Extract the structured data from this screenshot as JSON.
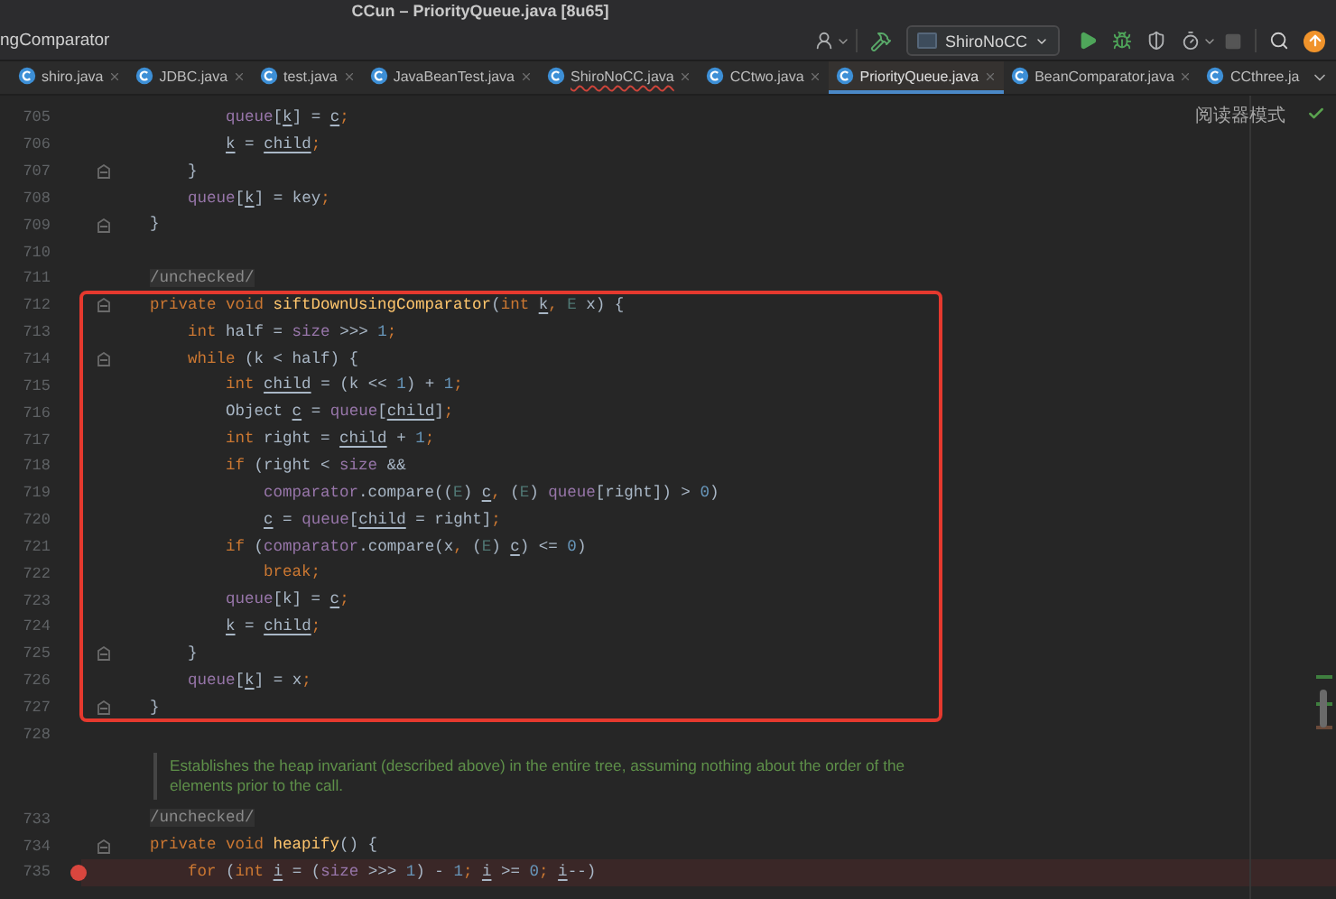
{
  "window": {
    "title": "CCun – PriorityQueue.java [8u65]"
  },
  "toolbar": {
    "breadcrumb": "ngComparator",
    "run_config": "ShiroNoCC"
  },
  "tabs": [
    {
      "label": "shiro.java",
      "selected": false,
      "error": false,
      "closable": true
    },
    {
      "label": "JDBC.java",
      "selected": false,
      "error": false,
      "closable": true
    },
    {
      "label": "test.java",
      "selected": false,
      "error": false,
      "closable": true
    },
    {
      "label": "JavaBeanTest.java",
      "selected": false,
      "error": false,
      "closable": true
    },
    {
      "label": "ShiroNoCC.java",
      "selected": false,
      "error": true,
      "closable": true
    },
    {
      "label": "CCtwo.java",
      "selected": false,
      "error": false,
      "closable": true
    },
    {
      "label": "PriorityQueue.java",
      "selected": true,
      "error": false,
      "closable": true
    },
    {
      "label": "BeanComparator.java",
      "selected": false,
      "error": false,
      "closable": true
    },
    {
      "label": "CCthree.ja",
      "selected": false,
      "error": false,
      "closable": false
    }
  ],
  "editor": {
    "reader_mode": "阅读器模式",
    "sections": [
      {
        "kind": "plain",
        "lines": [
          {
            "number": "705",
            "fold": false,
            "breakpoint": false,
            "tokens": [
              {
                "text": "            queue",
                "kind": "field"
              },
              {
                "text": "[",
                "kind": "plain"
              },
              {
                "text": "k",
                "kind": "var"
              },
              {
                "text": "] = ",
                "kind": "plain"
              },
              {
                "text": "c",
                "kind": "var"
              },
              {
                "text": ";",
                "kind": "punct"
              }
            ]
          },
          {
            "number": "706",
            "fold": false,
            "breakpoint": false,
            "tokens": [
              {
                "text": "            k",
                "kind": "var"
              },
              {
                "text": " = ",
                "kind": "plain"
              },
              {
                "text": "child",
                "kind": "var"
              },
              {
                "text": ";",
                "kind": "punct"
              }
            ]
          },
          {
            "number": "707",
            "fold": true,
            "breakpoint": false,
            "tokens": [
              {
                "text": "        }",
                "kind": "plain"
              }
            ]
          },
          {
            "number": "708",
            "fold": false,
            "breakpoint": false,
            "tokens": [
              {
                "text": "        queue",
                "kind": "field"
              },
              {
                "text": "[",
                "kind": "plain"
              },
              {
                "text": "k",
                "kind": "var"
              },
              {
                "text": "] = key",
                "kind": "plain"
              },
              {
                "text": ";",
                "kind": "punct"
              }
            ]
          },
          {
            "number": "709",
            "fold": true,
            "breakpoint": false,
            "tokens": [
              {
                "text": "    }",
                "kind": "plain"
              }
            ]
          },
          {
            "number": "710",
            "fold": false,
            "breakpoint": false
          },
          {
            "number": "711",
            "fold": false,
            "breakpoint": false,
            "tokens": [
              {
                "text": "    /unchecked/",
                "kind": "annotation"
              }
            ]
          }
        ]
      },
      {
        "kind": "boxed",
        "lines": [
          {
            "number": "712",
            "fold": true,
            "breakpoint": false,
            "tokens": [
              {
                "text": "    private void ",
                "kind": "kw"
              },
              {
                "text": "siftDownUsingComparator",
                "kind": "method"
              },
              {
                "text": "(",
                "kind": "plain"
              },
              {
                "text": "int ",
                "kind": "kw"
              },
              {
                "text": "k",
                "kind": "var"
              },
              {
                "text": ", ",
                "kind": "punct"
              },
              {
                "text": "E",
                "kind": "type"
              },
              {
                "text": " x) {",
                "kind": "plain"
              }
            ]
          },
          {
            "number": "713",
            "fold": false,
            "breakpoint": false,
            "tokens": [
              {
                "text": "        int ",
                "kind": "kw"
              },
              {
                "text": "half = ",
                "kind": "plain"
              },
              {
                "text": "size",
                "kind": "field"
              },
              {
                "text": " >>> ",
                "kind": "plain"
              },
              {
                "text": "1",
                "kind": "num"
              },
              {
                "text": ";",
                "kind": "punct"
              }
            ]
          },
          {
            "number": "714",
            "fold": true,
            "breakpoint": false,
            "tokens": [
              {
                "text": "        while ",
                "kind": "kw"
              },
              {
                "text": "(k < half) {",
                "kind": "plain"
              }
            ]
          },
          {
            "number": "715",
            "fold": false,
            "breakpoint": false,
            "tokens": [
              {
                "text": "            int ",
                "kind": "kw"
              },
              {
                "text": "child",
                "kind": "var"
              },
              {
                "text": " = (k << ",
                "kind": "plain"
              },
              {
                "text": "1",
                "kind": "num"
              },
              {
                "text": ") + ",
                "kind": "plain"
              },
              {
                "text": "1",
                "kind": "num"
              },
              {
                "text": ";",
                "kind": "punct"
              }
            ]
          },
          {
            "number": "716",
            "fold": false,
            "breakpoint": false,
            "tokens": [
              {
                "text": "            Object ",
                "kind": "plain"
              },
              {
                "text": "c",
                "kind": "var"
              },
              {
                "text": " = ",
                "kind": "plain"
              },
              {
                "text": "queue",
                "kind": "field"
              },
              {
                "text": "[",
                "kind": "plain"
              },
              {
                "text": "child",
                "kind": "var"
              },
              {
                "text": "]",
                "kind": "plain"
              },
              {
                "text": ";",
                "kind": "punct"
              }
            ]
          },
          {
            "number": "717",
            "fold": false,
            "breakpoint": false,
            "tokens": [
              {
                "text": "            int ",
                "kind": "kw"
              },
              {
                "text": "right = ",
                "kind": "plain"
              },
              {
                "text": "child",
                "kind": "var"
              },
              {
                "text": " + ",
                "kind": "plain"
              },
              {
                "text": "1",
                "kind": "num"
              },
              {
                "text": ";",
                "kind": "punct"
              }
            ]
          },
          {
            "number": "718",
            "fold": false,
            "breakpoint": false,
            "tokens": [
              {
                "text": "            if ",
                "kind": "kw"
              },
              {
                "text": "(right < ",
                "kind": "plain"
              },
              {
                "text": "size",
                "kind": "field"
              },
              {
                "text": " &&",
                "kind": "plain"
              }
            ]
          },
          {
            "number": "719",
            "fold": false,
            "breakpoint": false,
            "tokens": [
              {
                "text": "                comparator",
                "kind": "field"
              },
              {
                "text": ".compare((",
                "kind": "plain"
              },
              {
                "text": "E",
                "kind": "type"
              },
              {
                "text": ") ",
                "kind": "plain"
              },
              {
                "text": "c",
                "kind": "var"
              },
              {
                "text": ", ",
                "kind": "punct"
              },
              {
                "text": "(",
                "kind": "plain"
              },
              {
                "text": "E",
                "kind": "type"
              },
              {
                "text": ") ",
                "kind": "plain"
              },
              {
                "text": "queue",
                "kind": "field"
              },
              {
                "text": "[right]) > ",
                "kind": "plain"
              },
              {
                "text": "0",
                "kind": "num"
              },
              {
                "text": ")",
                "kind": "plain"
              }
            ]
          },
          {
            "number": "720",
            "fold": false,
            "breakpoint": false,
            "tokens": [
              {
                "text": "                c",
                "kind": "var"
              },
              {
                "text": " = ",
                "kind": "plain"
              },
              {
                "text": "queue",
                "kind": "field"
              },
              {
                "text": "[",
                "kind": "plain"
              },
              {
                "text": "child",
                "kind": "var"
              },
              {
                "text": " = right]",
                "kind": "plain"
              },
              {
                "text": ";",
                "kind": "punct"
              }
            ]
          },
          {
            "number": "721",
            "fold": false,
            "breakpoint": false,
            "tokens": [
              {
                "text": "            if ",
                "kind": "kw"
              },
              {
                "text": "(",
                "kind": "plain"
              },
              {
                "text": "comparator",
                "kind": "field"
              },
              {
                "text": ".compare(x",
                "kind": "plain"
              },
              {
                "text": ", ",
                "kind": "punct"
              },
              {
                "text": "(",
                "kind": "plain"
              },
              {
                "text": "E",
                "kind": "type"
              },
              {
                "text": ") ",
                "kind": "plain"
              },
              {
                "text": "c",
                "kind": "var"
              },
              {
                "text": ") <= ",
                "kind": "plain"
              },
              {
                "text": "0",
                "kind": "num"
              },
              {
                "text": ")",
                "kind": "plain"
              }
            ]
          },
          {
            "number": "722",
            "fold": false,
            "breakpoint": false,
            "tokens": [
              {
                "text": "                break",
                "kind": "kw"
              },
              {
                "text": ";",
                "kind": "punct"
              }
            ]
          },
          {
            "number": "723",
            "fold": false,
            "breakpoint": false,
            "tokens": [
              {
                "text": "            queue",
                "kind": "field"
              },
              {
                "text": "[k] = ",
                "kind": "plain"
              },
              {
                "text": "c",
                "kind": "var"
              },
              {
                "text": ";",
                "kind": "punct"
              }
            ]
          },
          {
            "number": "724",
            "fold": false,
            "breakpoint": false,
            "tokens": [
              {
                "text": "            k",
                "kind": "var"
              },
              {
                "text": " = ",
                "kind": "plain"
              },
              {
                "text": "child",
                "kind": "var"
              },
              {
                "text": ";",
                "kind": "punct"
              }
            ]
          },
          {
            "number": "725",
            "fold": true,
            "breakpoint": false,
            "tokens": [
              {
                "text": "        }",
                "kind": "plain"
              }
            ]
          },
          {
            "number": "726",
            "fold": false,
            "breakpoint": false,
            "tokens": [
              {
                "text": "        queue",
                "kind": "field"
              },
              {
                "text": "[",
                "kind": "plain"
              },
              {
                "text": "k",
                "kind": "var"
              },
              {
                "text": "] = x",
                "kind": "plain"
              },
              {
                "text": ";",
                "kind": "punct"
              }
            ]
          },
          {
            "number": "727",
            "fold": true,
            "breakpoint": false,
            "tokens": [
              {
                "text": "    }",
                "kind": "plain"
              }
            ]
          }
        ]
      },
      {
        "kind": "plain",
        "lines": [
          {
            "number": "728",
            "fold": false,
            "breakpoint": false
          }
        ]
      },
      {
        "kind": "doc",
        "text": "Establishes the heap invariant (described above) in the entire tree, assuming nothing about the order of the elements prior to the call."
      },
      {
        "kind": "plain",
        "lines": [
          {
            "number": "733",
            "fold": false,
            "breakpoint": false,
            "tokens": [
              {
                "text": "    /unchecked/",
                "kind": "annotation"
              }
            ]
          },
          {
            "number": "734",
            "fold": true,
            "breakpoint": false,
            "tokens": [
              {
                "text": "    private void ",
                "kind": "kw"
              },
              {
                "text": "heapify",
                "kind": "method"
              },
              {
                "text": "() {",
                "kind": "plain"
              }
            ]
          },
          {
            "number": "735",
            "fold": false,
            "breakpoint": true,
            "tokens": [
              {
                "text": "        for ",
                "kind": "kw"
              },
              {
                "text": "(",
                "kind": "plain"
              },
              {
                "text": "int ",
                "kind": "kw"
              },
              {
                "text": "i",
                "kind": "var"
              },
              {
                "text": " = (",
                "kind": "plain"
              },
              {
                "text": "size",
                "kind": "field"
              },
              {
                "text": " >>> ",
                "kind": "plain"
              },
              {
                "text": "1",
                "kind": "num"
              },
              {
                "text": ") - ",
                "kind": "plain"
              },
              {
                "text": "1",
                "kind": "num"
              },
              {
                "text": "; ",
                "kind": "punct"
              },
              {
                "text": "i",
                "kind": "var"
              },
              {
                "text": " >= ",
                "kind": "plain"
              },
              {
                "text": "0",
                "kind": "num"
              },
              {
                "text": "; ",
                "kind": "punct"
              },
              {
                "text": "i",
                "kind": "var"
              },
              {
                "text": "--)",
                "kind": "plain"
              }
            ]
          }
        ]
      }
    ]
  }
}
